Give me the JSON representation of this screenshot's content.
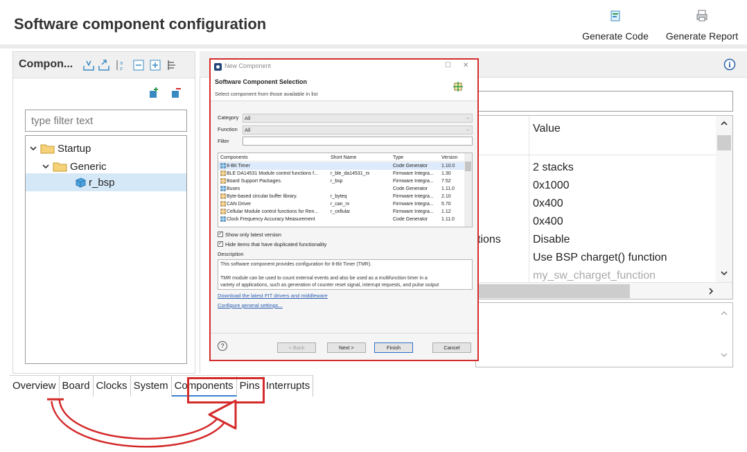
{
  "header": {
    "title": "Software component configuration",
    "generate_code": "Generate Code",
    "generate_report": "Generate Report"
  },
  "left_panel": {
    "title": "Compon...",
    "filter_placeholder": "type filter text",
    "tree": [
      {
        "label": "Startup",
        "expanded": true
      },
      {
        "label": "Generic",
        "expanded": true
      },
      {
        "label": "r_bsp",
        "selected": true
      }
    ]
  },
  "config_table": {
    "value_header": "Value",
    "partial_name": "tions",
    "values": [
      "2 stacks",
      "0x1000",
      "0x400",
      "0x400",
      "Disable",
      "Use BSP charget() function",
      "my_sw_charget_function"
    ]
  },
  "tabs": [
    "Overview",
    "Board",
    "Clocks",
    "System",
    "Components",
    "Pins",
    "Interrupts"
  ],
  "active_tab": "Components",
  "dialog": {
    "window_title": "New Component",
    "banner_title": "Software Component Selection",
    "banner_subtitle": "Select component from those available in list",
    "category_label": "Category",
    "category_value": "All",
    "function_label": "Function",
    "function_value": "All",
    "filter_label": "Filter",
    "columns": [
      "Components",
      "Short Name",
      "Type",
      "Version"
    ],
    "rows": [
      {
        "name": "8-Bit Timer",
        "short": "",
        "type": "Code Generator",
        "version": "1.10.0",
        "selected": true
      },
      {
        "name": "BLE DA14531 Module control functions f...",
        "short": "r_ble_da14531_rx",
        "type": "Firmware Integra...",
        "version": "1.30"
      },
      {
        "name": "Board Support Packages.",
        "short": "r_bsp",
        "type": "Firmware Integra...",
        "version": "7.52"
      },
      {
        "name": "Buses",
        "short": "",
        "type": "Code Generator",
        "version": "1.11.0"
      },
      {
        "name": "Byte-based circular buffer library.",
        "short": "r_byteq",
        "type": "Firmware Integra...",
        "version": "2.10"
      },
      {
        "name": "CAN Driver",
        "short": "r_can_rx",
        "type": "Firmware Integra...",
        "version": "5.70"
      },
      {
        "name": "Cellular Module control functions for Ren...",
        "short": "r_cellular",
        "type": "Firmware Integra...",
        "version": "1.12"
      },
      {
        "name": "Clock Frequency Accuracy Measurement",
        "short": "",
        "type": "Code Generator",
        "version": "1.11.0"
      }
    ],
    "show_latest": "Show only latest version",
    "hide_duplicates": "Hide items that have duplicated functionality",
    "description_label": "Description",
    "description_lines": [
      "This software component provides configuration for 8-Bit Timer (TMR).",
      "",
      "TMR module can be used to count external events and also be used as a multifunction timer in a",
      "variety of applications, such as generation of counter reset signal, interrupt requests, and pulse output"
    ],
    "link_download": "Download the latest FIT drivers and middleware",
    "link_configure": "Configure general settings...",
    "btn_back": "< Back",
    "btn_next": "Next >",
    "btn_finish": "Finish",
    "btn_cancel": "Cancel",
    "help": "?"
  },
  "colors": {
    "highlight": "#d42a2a",
    "accent": "#3b7fd1",
    "folder": "#f0c24a"
  }
}
